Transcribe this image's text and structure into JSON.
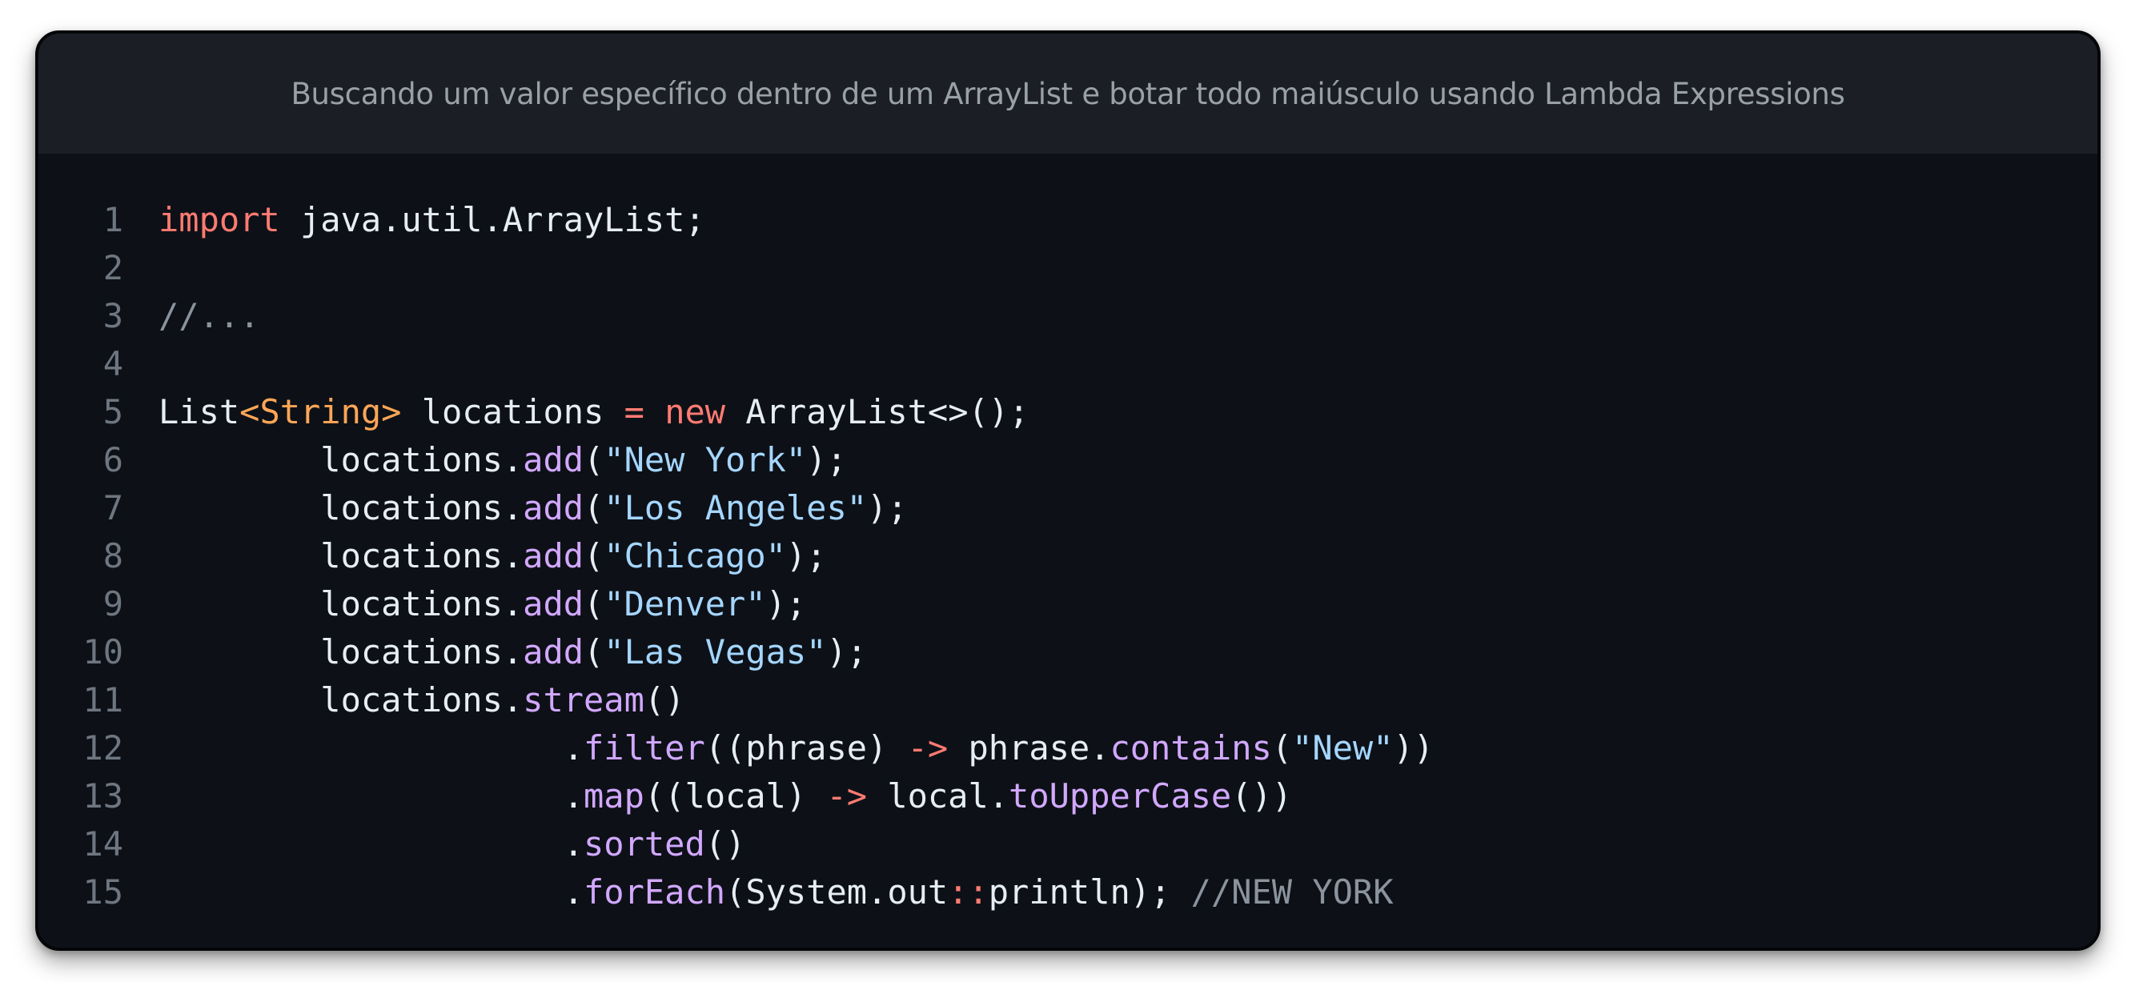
{
  "title": "Buscando um valor específico dentro de um ArrayList e botar todo maiúsculo usando Lambda Expressions",
  "line_numbers": [
    "1",
    "2",
    "3",
    "4",
    "5",
    "6",
    "7",
    "8",
    "9",
    "10",
    "11",
    "12",
    "13",
    "14",
    "15"
  ],
  "code": {
    "l1": {
      "kw_import": "import",
      "rest": " java.util.ArrayList;"
    },
    "l3": {
      "comment": "//..."
    },
    "l5": {
      "list": "List",
      "generic": "<String>",
      "var": " locations ",
      "eq": "=",
      "space": " ",
      "kw_new": "new",
      "rest": " ArrayList<>();"
    },
    "l6": {
      "indent": "        locations.",
      "fn": "add",
      "open": "(",
      "str": "\"New York\"",
      "close": ");"
    },
    "l7": {
      "indent": "        locations.",
      "fn": "add",
      "open": "(",
      "str": "\"Los Angeles\"",
      "close": ");"
    },
    "l8": {
      "indent": "        locations.",
      "fn": "add",
      "open": "(",
      "str": "\"Chicago\"",
      "close": ");"
    },
    "l9": {
      "indent": "        locations.",
      "fn": "add",
      "open": "(",
      "str": "\"Denver\"",
      "close": ");"
    },
    "l10": {
      "indent": "        locations.",
      "fn": "add",
      "open": "(",
      "str": "\"Las Vegas\"",
      "close": ");"
    },
    "l11": {
      "indent": "        locations.",
      "fn": "stream",
      "close": "()"
    },
    "l12": {
      "indent": "                    .",
      "fn": "filter",
      "mid": "((phrase) ",
      "arrow": "->",
      "mid2": " phrase.",
      "fn2": "contains",
      "open": "(",
      "str": "\"New\"",
      "close": "))"
    },
    "l13": {
      "indent": "                    .",
      "fn": "map",
      "mid": "((local) ",
      "arrow": "->",
      "mid2": " local.",
      "fn2": "toUpperCase",
      "close": "())"
    },
    "l14": {
      "indent": "                    .",
      "fn": "sorted",
      "close": "()"
    },
    "l15": {
      "indent": "                    .",
      "fn": "forEach",
      "mid": "(System.out",
      "dcolon": "::",
      "mid2": "println); ",
      "comment": "//NEW YORK"
    }
  }
}
